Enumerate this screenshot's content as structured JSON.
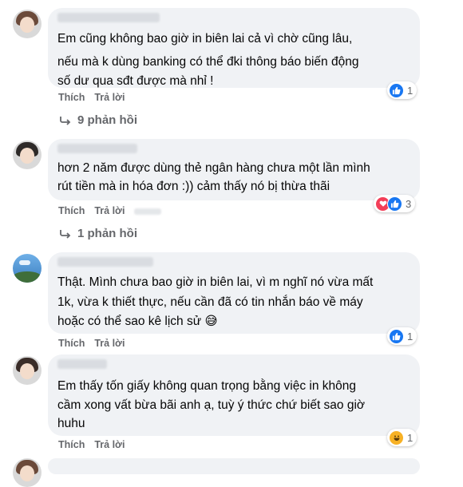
{
  "comments": [
    {
      "lines": [
        "Em cũng không bao giờ in biên lai cả vì chờ cũng lâu,",
        "nếu mà k dùng banking có thể đki thông báo biến động",
        "số dư qua sđt được mà nhỉ !"
      ],
      "like_label": "Thích",
      "reply_label": "Trả lời",
      "reaction_count": "1",
      "reaction_types": [
        "like"
      ],
      "replies_label": "9 phản hồi"
    },
    {
      "lines": [
        "hơn 2 năm được dùng thẻ ngân hàng chưa một lần mình",
        "rút tiền mà in hóa đơn :)) cảm thấy nó bị thừa thãi"
      ],
      "like_label": "Thích",
      "reply_label": "Trả lời",
      "reaction_count": "3",
      "reaction_types": [
        "love",
        "like"
      ],
      "replies_label": "1 phản hồi"
    },
    {
      "lines": [
        "Thật. Mình chưa bao giờ in biên lai, vì m nghĩ nó vừa mất",
        "1k, vừa k thiết thực, nếu cần đã có tin nhắn báo về máy",
        "hoặc có thể sao kê lịch sử 😅"
      ],
      "like_label": "Thích",
      "reply_label": "Trả lời",
      "reaction_count": "1",
      "reaction_types": [
        "like"
      ]
    },
    {
      "lines": [
        "Em thấy tốn giấy không quan trọng bằng việc in không",
        "cầm xong vất bừa bãi anh ạ, tuỳ ý thức chứ biết sao giờ",
        "huhu"
      ],
      "like_label": "Thích",
      "reply_label": "Trả lời",
      "reaction_count": "1",
      "reaction_types": [
        "haha"
      ]
    }
  ]
}
